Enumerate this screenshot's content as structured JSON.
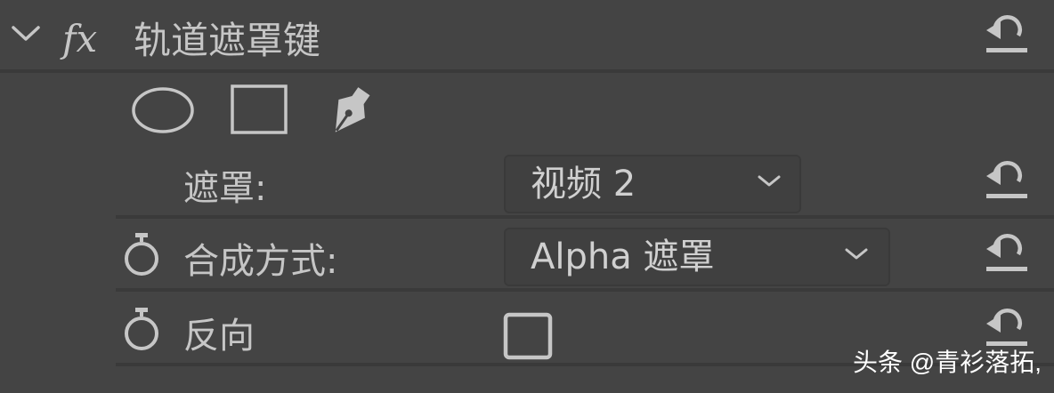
{
  "effect": {
    "title": "轨道遮罩键",
    "fx_label": "fx"
  },
  "mask_tools": [
    "ellipse-mask-tool",
    "rectangle-mask-tool",
    "pen-mask-tool"
  ],
  "params": {
    "mask": {
      "label": "遮罩:",
      "value": "视频 2"
    },
    "composite": {
      "label": "合成方式:",
      "value": "Alpha 遮罩"
    },
    "reverse": {
      "label": "反向",
      "checked": false
    }
  },
  "colors": {
    "background": "#444444",
    "separator": "#3a3a3a",
    "text": "#c6c6c6"
  },
  "watermark": "头条 @青衫落拓,"
}
